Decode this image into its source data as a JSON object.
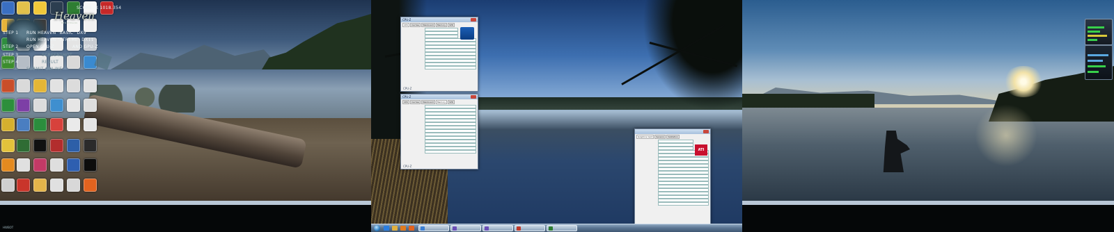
{
  "taskbar": {
    "time": "",
    "date": "",
    "tasks": [
      {
        "label": "",
        "color": "#3b7fd4"
      },
      {
        "label": "",
        "color": "#6b4fb8"
      },
      {
        "label": "",
        "color": "#6b4fb8"
      },
      {
        "label": "",
        "color": "#c0392b"
      },
      {
        "label": "",
        "color": "#2e7d32"
      }
    ],
    "pinned": [
      {
        "icon": "internet-explorer-icon",
        "color": "#2a7ee0"
      },
      {
        "icon": "explorer-folder-icon",
        "color": "#e0b040"
      },
      {
        "icon": "media-player-icon",
        "color": "#e07b20"
      },
      {
        "icon": "firefox-icon",
        "color": "#e2631f"
      }
    ]
  },
  "cpuz_cpu": {
    "title": "CPU-Z",
    "tabs": [
      "CPU",
      "Caches",
      "Mainboard",
      "Memory",
      "SPD",
      "Graphics",
      "About"
    ],
    "brand": "CPU-Z"
  },
  "cpuz_memory": {
    "title": "CPU-Z",
    "tabs": [
      "CPU",
      "Caches",
      "Mainboard",
      "Memory",
      "SPD",
      "Graphics",
      "About"
    ],
    "brand": "CPU-Z"
  },
  "heaven": {
    "title": "",
    "score_line": "SCORE: X 1018.354",
    "logo": "Heaven",
    "logo_sub": "BENCHMARK",
    "steps": [
      {
        "label": "STEP 1",
        "action": "RUN HEAVEN \"BASIC\" DX9",
        "dim": false
      },
      {
        "label": "",
        "action": "RUN HEAVEN \"XTREME\" DX11",
        "dim": false
      },
      {
        "label": "STEP 2",
        "action": "OPEN CPU-Z",
        "extra": "AND GPU-Z",
        "dim": false
      },
      {
        "label": "STEP 3",
        "action": "SCREENSHOT",
        "dim": true
      },
      {
        "label": "STEP 4",
        "action": "RESULT",
        "dim": true
      },
      {
        "label": "",
        "action": "SUBMIT ONLINE",
        "dim": true
      }
    ],
    "version": "HWBOT"
  },
  "gpuz": {
    "title": "",
    "tabs": [
      "Graphics Card",
      "Sensors",
      "Validation"
    ],
    "vendor_logo": "ATI"
  },
  "gadgets": {
    "cpu_meter": "",
    "network": ""
  },
  "colors": {
    "taskbar_start": "#2f7fc2",
    "window_frame": "#6f829a",
    "heaven_bg": "#2c4d5e"
  }
}
